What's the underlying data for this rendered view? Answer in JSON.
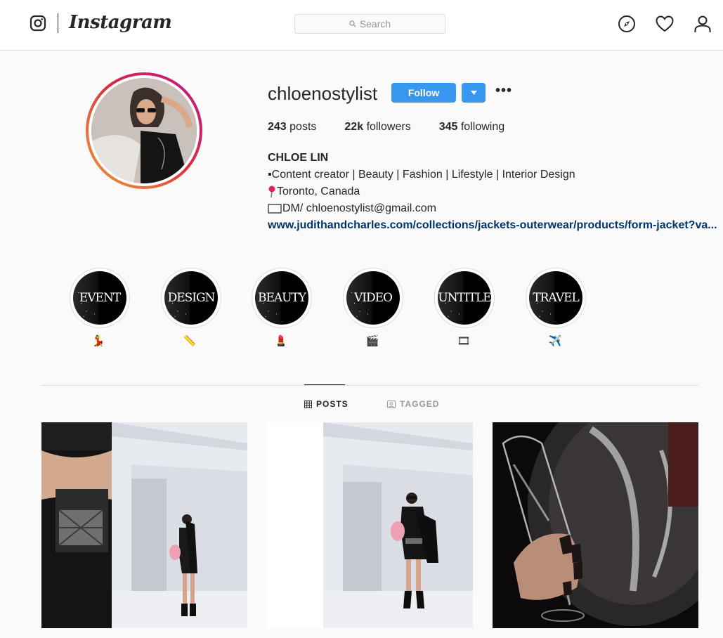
{
  "nav": {
    "brand": "Instagram",
    "search_placeholder": "Search",
    "icons": [
      "instagram-logo-icon",
      "explore-compass-icon",
      "activity-heart-icon",
      "profile-person-icon"
    ]
  },
  "profile": {
    "username": "chloenostylist",
    "follow_label": "Follow",
    "more_label": "•••",
    "stats": {
      "posts_count": "243",
      "posts_label": "posts",
      "followers_count": "22k",
      "followers_label": "followers",
      "following_count": "345",
      "following_label": "following"
    },
    "bio": {
      "full_name": "CHLOE LIN",
      "line1": "▪Content creator | Beauty | Fashion | Lifestyle | Interior Design",
      "line2": "Toronto, Canada",
      "line3": "DM/ chloenostylist@gmail.com",
      "website": "www.judithandcharles.com/collections/jackets-outerwear/products/form-jacket?va..."
    }
  },
  "highlights": [
    {
      "title": "EVENT",
      "emoji": "💃"
    },
    {
      "title": "DESIGN",
      "emoji": "📏"
    },
    {
      "title": "BEAUTY",
      "emoji": "💄"
    },
    {
      "title": "VIDEO",
      "emoji": "🎬"
    },
    {
      "title": "UNTITLE",
      "emoji": "🎞"
    },
    {
      "title": "TRAVEL",
      "emoji": "✈️"
    }
  ],
  "tabs": {
    "posts_label": "POSTS",
    "tagged_label": "TAGGED",
    "active": "POSTS"
  },
  "colors": {
    "accent_blue": "#3897f0",
    "link_blue": "#003569",
    "border": "#dbdbdb",
    "background": "#fafafa"
  }
}
